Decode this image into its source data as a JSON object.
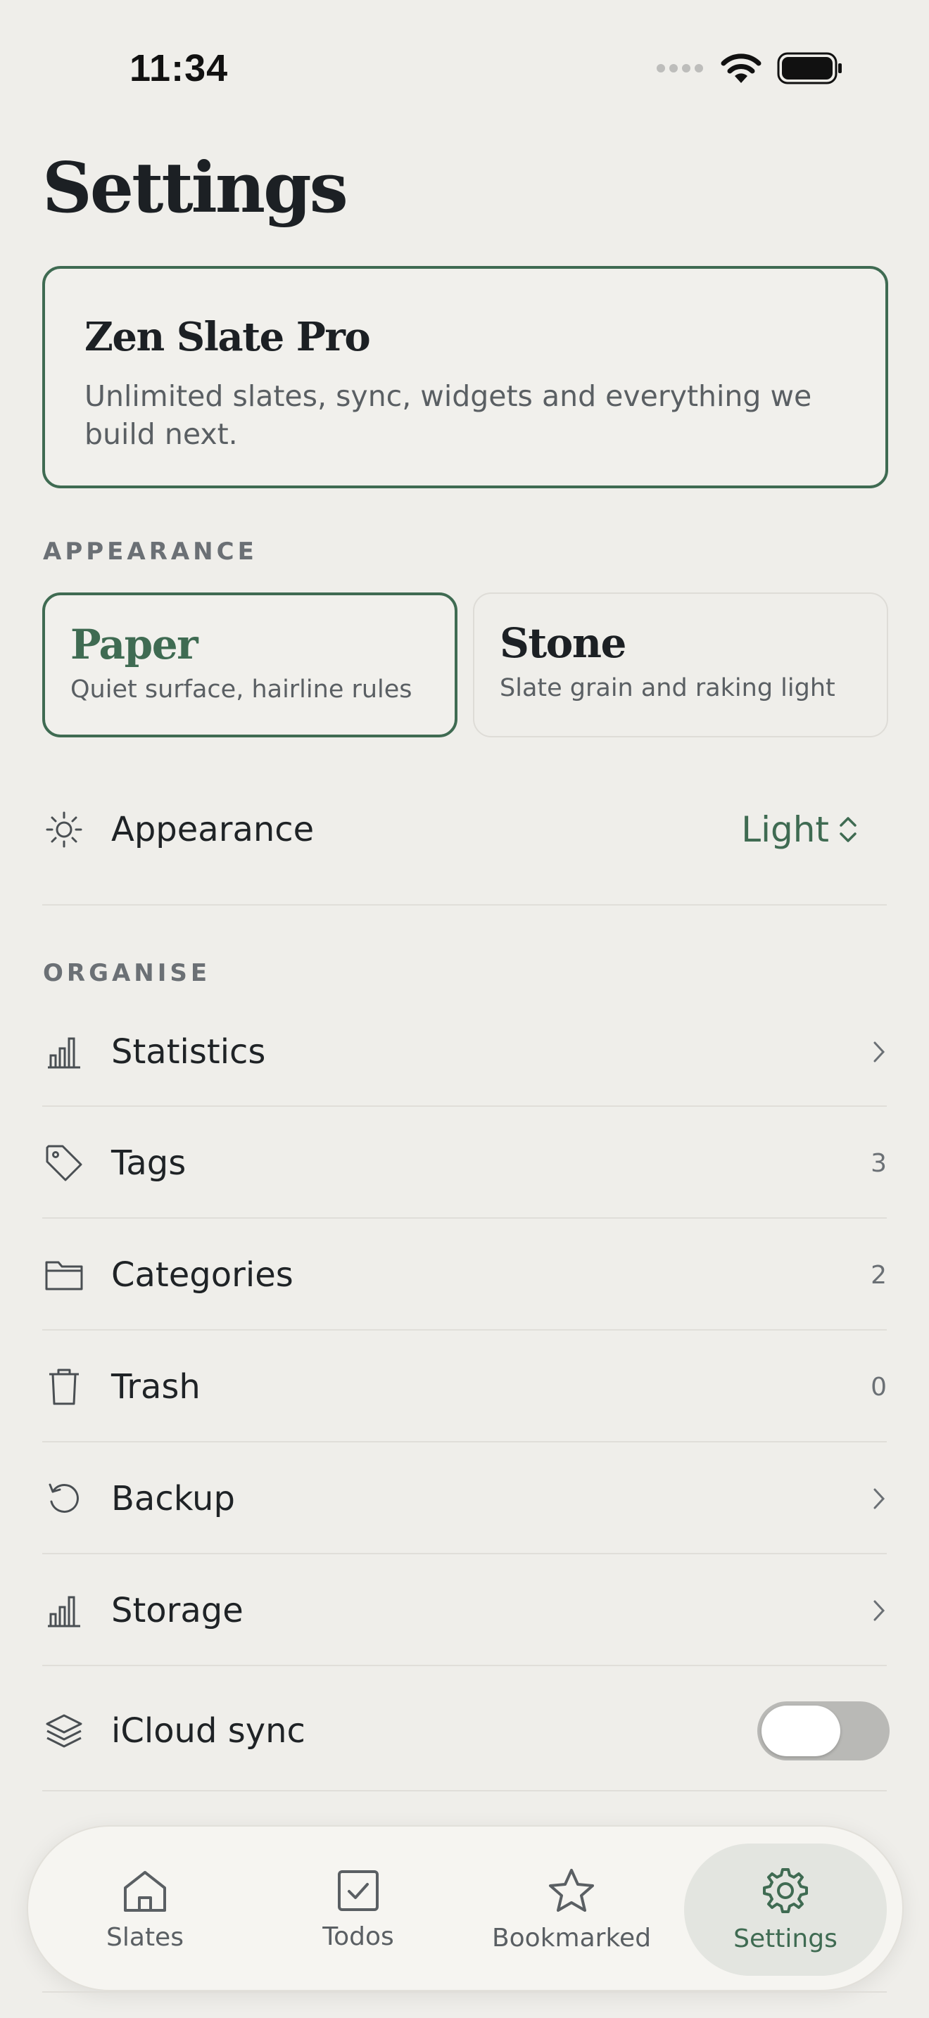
{
  "status": {
    "time": "11:34"
  },
  "header": {
    "title": "Settings"
  },
  "pro": {
    "title": "Zen Slate Pro",
    "description": "Unlimited slates, sync, widgets and everything we build next."
  },
  "appearance_section": {
    "label": "APPEARANCE",
    "themes": [
      {
        "name": "Paper",
        "description": "Quiet surface, hairline rules",
        "selected": true
      },
      {
        "name": "Stone",
        "description": "Slate grain and raking light",
        "selected": false
      }
    ],
    "mode": {
      "label": "Appearance",
      "value": "Light",
      "icon": "sun-icon"
    }
  },
  "organise_section": {
    "label": "ORGANISE",
    "items": [
      {
        "label": "Statistics",
        "icon": "bar-chart-icon",
        "trail": "chevron"
      },
      {
        "label": "Tags",
        "icon": "tag-icon",
        "count": "3"
      },
      {
        "label": "Categories",
        "icon": "folder-icon",
        "count": "2"
      },
      {
        "label": "Trash",
        "icon": "trash-icon",
        "count": "0"
      },
      {
        "label": "Backup",
        "icon": "restore-icon",
        "trail": "chevron"
      },
      {
        "label": "Storage",
        "icon": "bar-chart-icon",
        "trail": "chevron"
      },
      {
        "label": "iCloud sync",
        "icon": "layers-icon",
        "toggle": false
      }
    ]
  },
  "tabs": [
    {
      "label": "Slates",
      "icon": "home-icon"
    },
    {
      "label": "Todos",
      "icon": "checkbox-icon"
    },
    {
      "label": "Bookmarked",
      "icon": "star-icon"
    },
    {
      "label": "Settings",
      "icon": "gear-icon",
      "active": true
    }
  ],
  "colors": {
    "accent": "#3f6b52",
    "background": "#efeeea",
    "text": "#1f2326",
    "muted": "#6b7075"
  }
}
